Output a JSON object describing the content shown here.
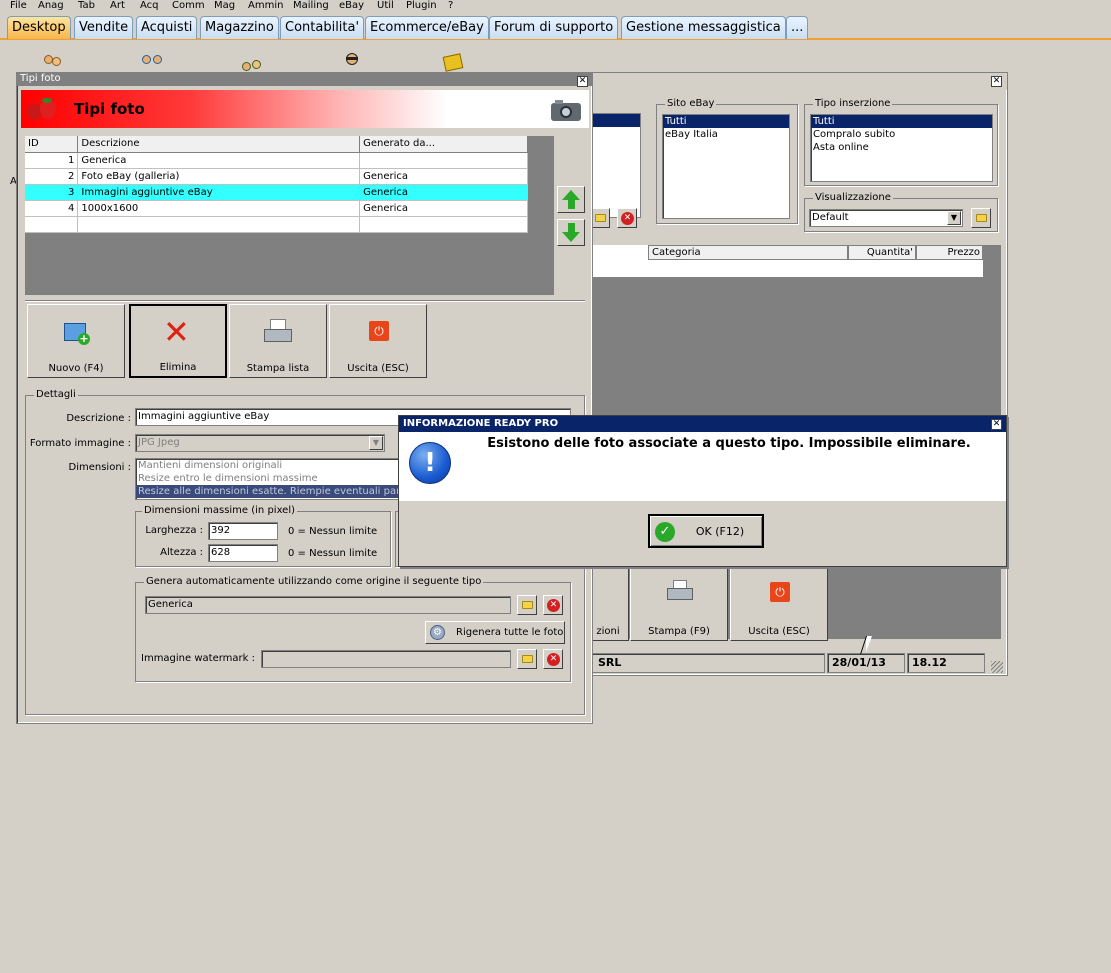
{
  "menu": [
    "File",
    "Anag",
    "Tab",
    "Art",
    "Acq",
    "Comm",
    "Mag",
    "Ammin",
    "Mailing",
    "eBay",
    "Util",
    "Plugin",
    "?"
  ],
  "tabs": [
    "Desktop",
    "Vendite",
    "Acquisti",
    "Magazzino",
    "Contabilita'",
    "Ecommerce/eBay",
    "Forum di supporto",
    "Gestione messaggistica",
    "..."
  ],
  "desktop_letter": "A",
  "back_window": {
    "sito_ebay_label": "Sito eBay",
    "sito_ebay_options": [
      "Tutti",
      "eBay Italia"
    ],
    "tipo_inserzione_label": "Tipo inserzione",
    "tipo_inserzione_options": [
      "Tutti",
      "Compralo subito",
      "Asta online"
    ],
    "visualizzazione_label": "Visualizzazione",
    "visualizzazione_value": "Default",
    "columns": [
      "Categoria",
      "Quantita'",
      "Prezzo"
    ],
    "btn_partial": "zioni",
    "btn_stampa": "Stampa (F9)",
    "btn_uscita": "Uscita (ESC)",
    "status_company": "SRL",
    "status_date": "28/01/13",
    "status_time": "18.12"
  },
  "tipi_foto": {
    "window_title": "Tipi foto",
    "header_title": "Tipi foto",
    "columns": [
      "ID",
      "Descrizione",
      "Generato da..."
    ],
    "rows": [
      {
        "id": "1",
        "descrizione": "Generica",
        "generato": ""
      },
      {
        "id": "2",
        "descrizione": "Foto eBay (galleria)",
        "generato": "Generica"
      },
      {
        "id": "3",
        "descrizione": "Immagini aggiuntive eBay",
        "generato": "Generica"
      },
      {
        "id": "4",
        "descrizione": "1000x1600",
        "generato": "Generica"
      }
    ],
    "selected_row_color": "#33ffff",
    "btn_nuovo": "Nuovo (F4)",
    "btn_elimina": "Elimina",
    "btn_stampa": "Stampa lista",
    "btn_uscita": "Uscita (ESC)",
    "dettagli_label": "Dettagli",
    "descrizione_label": "Descrizione :",
    "descrizione_value": "Immagini aggiuntive eBay",
    "formato_label": "Formato immagine :",
    "formato_value": "JPG Jpeg",
    "dimensioni_label": "Dimensioni :",
    "dimensioni_options": [
      "Mantieni dimensioni originali",
      "Resize entro le dimensioni massime",
      "Resize alle dimensioni esatte. Riempie eventuali parti va"
    ],
    "dim_max_label": "Dimensioni massime (in pixel)",
    "larghezza_label": "Larghezza :",
    "larghezza_value": "392",
    "altezza_label": "Altezza :",
    "altezza_value": "628",
    "nessun_limite": "0 = Nessun limite",
    "genera_label": "Genera automaticamente utilizzando come origine il seguente tipo",
    "genera_value": "Generica",
    "rigenera_btn": "Rigenera tutte le foto",
    "watermark_label": "Immagine watermark :",
    "watermark_value": ""
  },
  "dialog": {
    "title": "INFORMAZIONE READY PRO",
    "message": "Esistono delle foto associate a questo tipo. Impossibile eliminare.",
    "ok_label": "OK (F12)"
  },
  "colors": {
    "tab_active": "#f7b64a",
    "dialog_titlebar": "#0a246a",
    "header_gradient_start": "#ff0000"
  }
}
